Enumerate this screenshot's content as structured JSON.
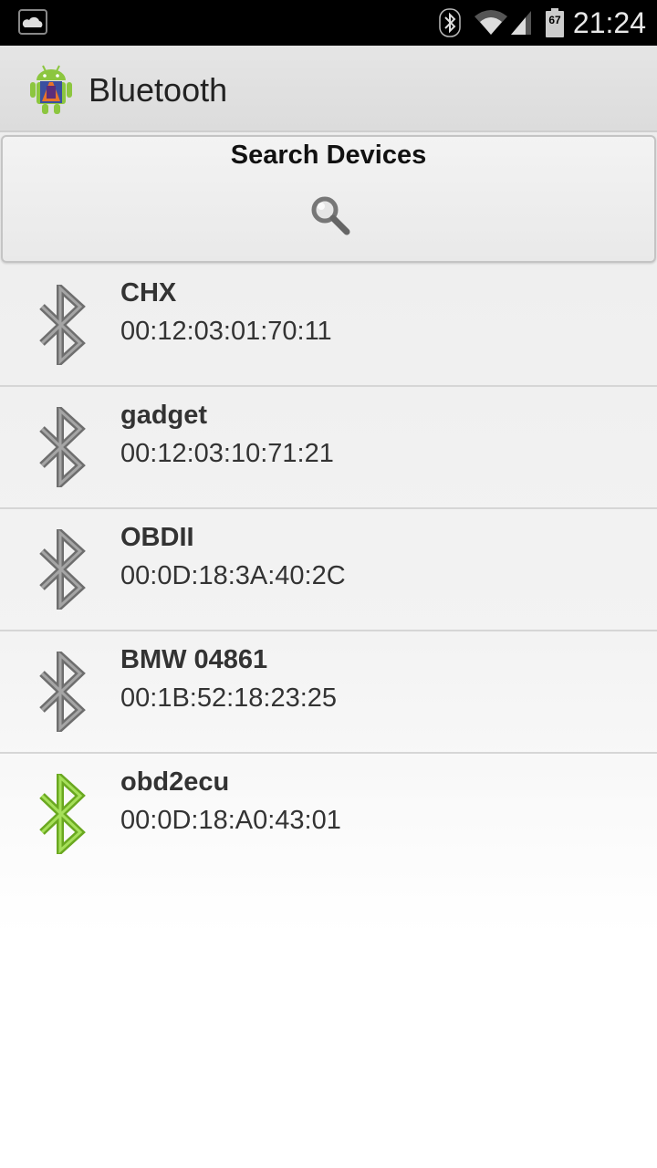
{
  "status_bar": {
    "time": "21:24",
    "battery_level": "67",
    "icons": [
      "cloud-icon",
      "bluetooth-icon",
      "wifi-icon",
      "signal-icon",
      "battery-icon"
    ]
  },
  "action_bar": {
    "title": "Bluetooth",
    "icon": "android-app-icon"
  },
  "search": {
    "label": "Search Devices",
    "icon": "search-icon"
  },
  "devices": [
    {
      "name": "CHX",
      "address": "00:12:03:01:70:11",
      "connected": false
    },
    {
      "name": "gadget",
      "address": "00:12:03:10:71:21",
      "connected": false
    },
    {
      "name": "OBDII",
      "address": "00:0D:18:3A:40:2C",
      "connected": false
    },
    {
      "name": "BMW 04861",
      "address": "00:1B:52:18:23:25",
      "connected": false
    },
    {
      "name": "obd2ecu",
      "address": "00:0D:18:A0:43:01",
      "connected": true
    }
  ],
  "colors": {
    "bt_inactive": "#7a7a7a",
    "bt_active": "#8cc63f"
  }
}
